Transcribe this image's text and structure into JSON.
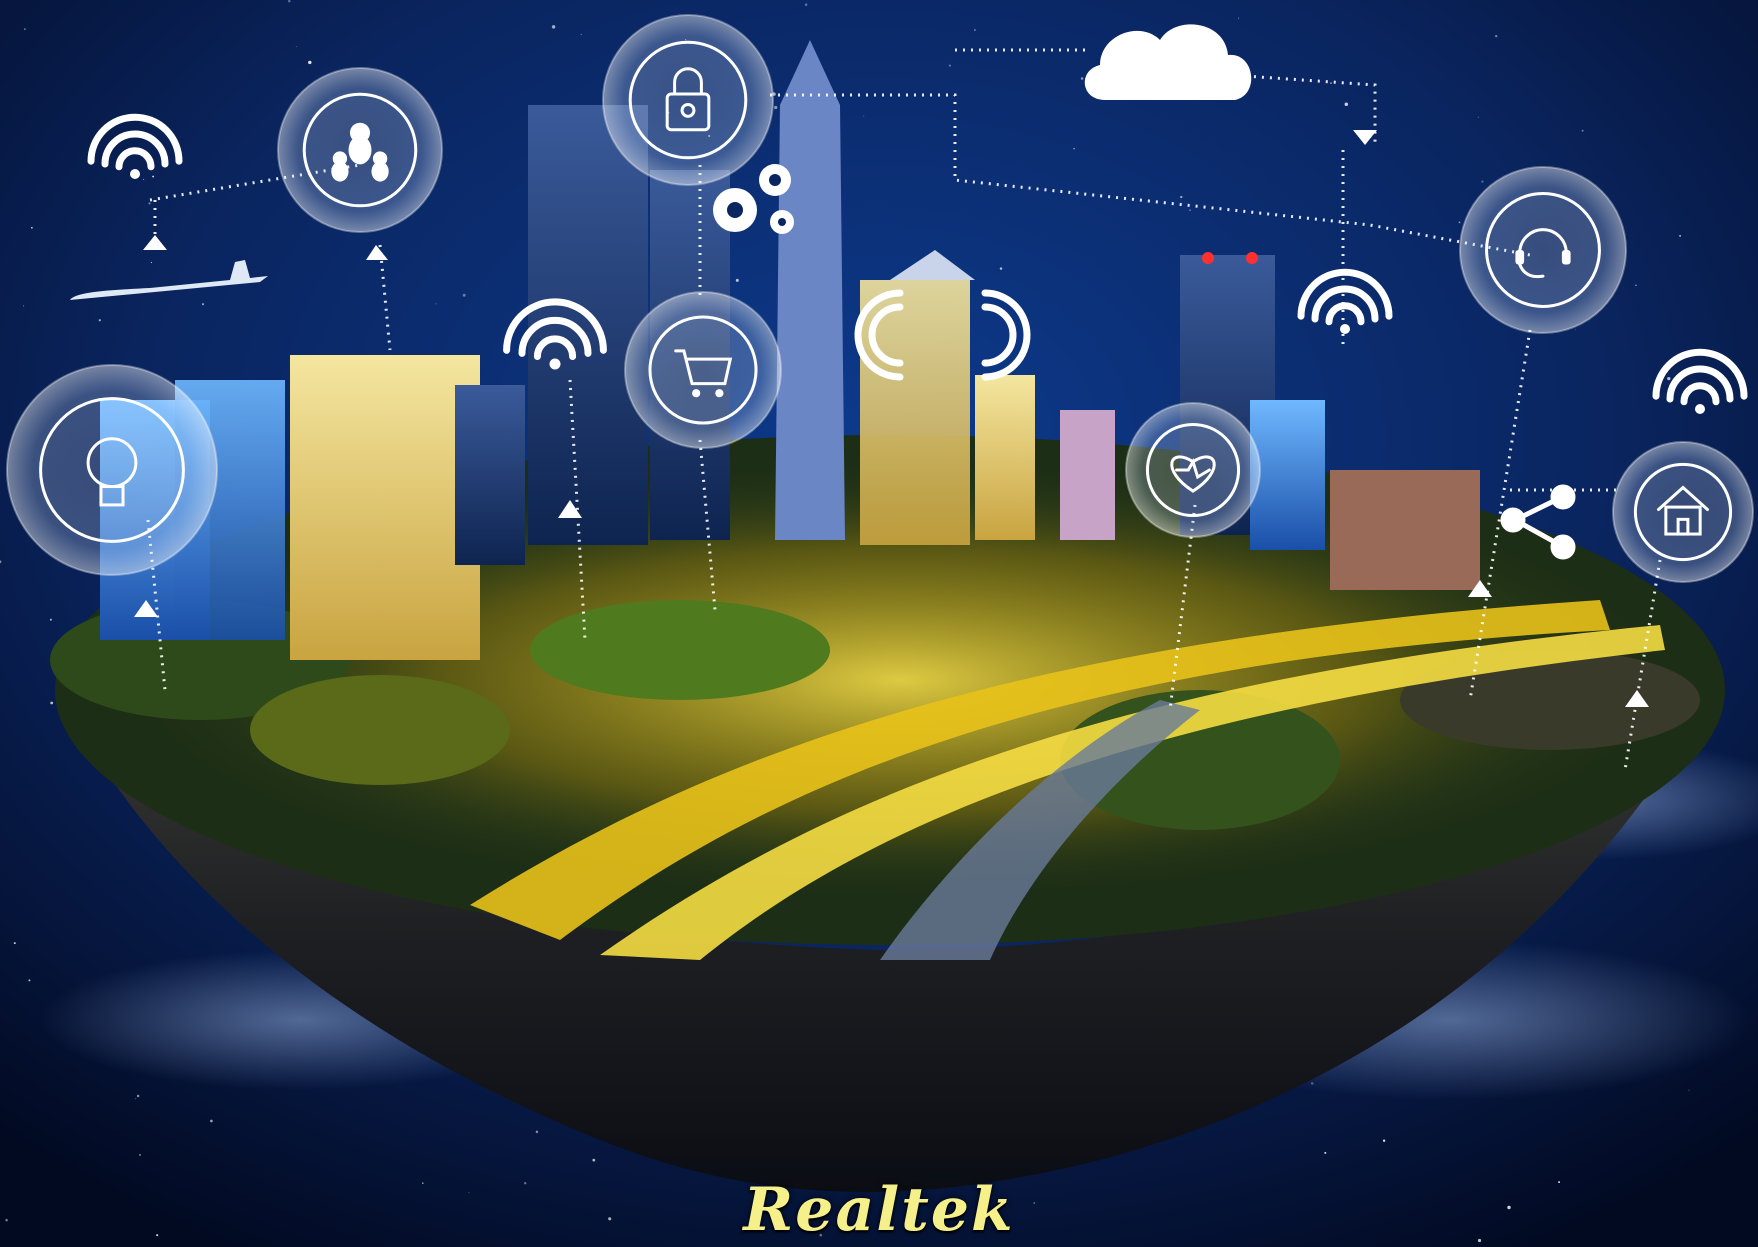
{
  "caption": "Realtek",
  "colors": {
    "sky_top": "#020a24",
    "sky_mid": "#0a2a6e",
    "city_glow": "#f2d21a",
    "icon_line": "#ffffff",
    "tower_light": "#ff3030"
  },
  "icons": [
    "wifi-icon",
    "plane-icon",
    "robot-family-icon",
    "lock-icon",
    "gears-icon",
    "cloud-icon",
    "shopping-cart-icon",
    "smart-bulb-icon",
    "heart-pulse-icon",
    "headset-icon",
    "share-icon",
    "home-icon"
  ]
}
